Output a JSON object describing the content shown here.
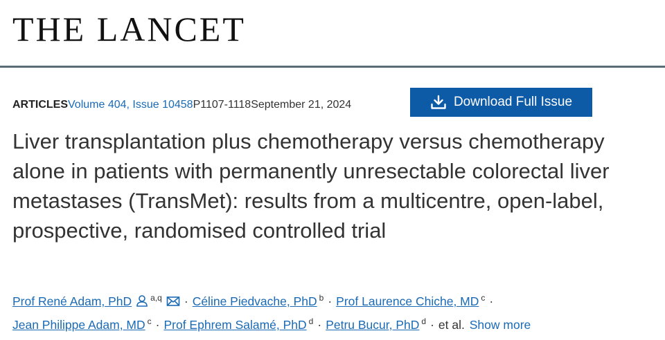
{
  "journal": {
    "name": "THE LANCET"
  },
  "article_meta": {
    "type": "ARTICLES",
    "volume_issue": "Volume 404, Issue 10458",
    "pages": "P1107-1118",
    "date": "September 21, 2024"
  },
  "toolbar": {
    "download_label": "Download Full Issue",
    "download_icon": "download-icon"
  },
  "article": {
    "title": "Liver transplantation plus chemotherapy versus chemotherapy alone in patients with permanently unresectable colorectal liver metastases (TransMet): results from a multicentre, open-label, prospective, randomised controlled trial"
  },
  "authors": [
    {
      "name": "Prof René Adam, PhD",
      "aff": "a,q",
      "icons": [
        "person-icon",
        "email-icon"
      ]
    },
    {
      "name": "Céline Piedvache, PhD",
      "aff": "b"
    },
    {
      "name": "Prof Laurence Chiche, MD",
      "aff": "c"
    },
    {
      "name": "Jean Philippe Adam, MD",
      "aff": "c"
    },
    {
      "name": "Prof Ephrem Salamé, PhD",
      "aff": "d"
    },
    {
      "name": "Petru Bucur, PhD",
      "aff": "d"
    }
  ],
  "authors_suffix": {
    "separator": "·",
    "et_al": "et al.",
    "show_more": "Show more"
  },
  "colors": {
    "link": "#1a6ab5",
    "button": "#0d5aa7",
    "rule": "#5b6b74"
  }
}
